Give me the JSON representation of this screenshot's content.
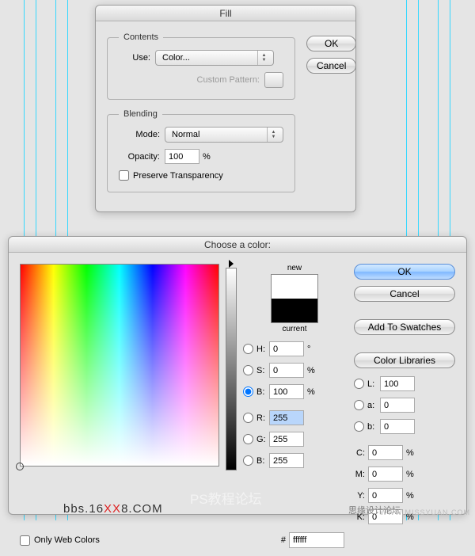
{
  "fill_dialog": {
    "title": "Fill",
    "contents": {
      "legend": "Contents",
      "use_label": "Use:",
      "use_value": "Color...",
      "custom_pattern_label": "Custom Pattern:"
    },
    "blending": {
      "legend": "Blending",
      "mode_label": "Mode:",
      "mode_value": "Normal",
      "opacity_label": "Opacity:",
      "opacity_value": "100",
      "opacity_unit": "%",
      "preserve_label": "Preserve Transparency"
    },
    "buttons": {
      "ok": "OK",
      "cancel": "Cancel"
    }
  },
  "picker_dialog": {
    "title": "Choose a color:",
    "new_label": "new",
    "current_label": "current",
    "only_web_label": "Only Web Colors",
    "hex_prefix": "#",
    "hex_value": "ffffff",
    "buttons": {
      "ok": "OK",
      "cancel": "Cancel",
      "add_swatches": "Add To Swatches",
      "color_libraries": "Color Libraries"
    },
    "hsb": {
      "h_label": "H:",
      "h_value": "0",
      "h_unit": "°",
      "s_label": "S:",
      "s_value": "0",
      "s_unit": "%",
      "b_label": "B:",
      "b_value": "100",
      "b_unit": "%"
    },
    "rgb": {
      "r_label": "R:",
      "r_value": "255",
      "g_label": "G:",
      "g_value": "255",
      "b_label": "B:",
      "b_value": "255"
    },
    "lab": {
      "l_label": "L:",
      "l_value": "100",
      "a_label": "a:",
      "a_value": "0",
      "b_label": "b:",
      "b_value": "0"
    },
    "cmyk": {
      "c_label": "C:",
      "c_value": "0",
      "unit": "%",
      "m_label": "M:",
      "m_value": "0",
      "y_label": "Y:",
      "y_value": "0",
      "k_label": "K:",
      "k_value": "0"
    }
  },
  "watermarks": {
    "bbs_prefix": "bbs.16",
    "bbs_xx": "XX",
    "bbs_suffix": "8.COM",
    "ps_forum": "PS教程论坛",
    "design_forum": "思缘设计论坛",
    "missyuan": "WWW.MISSYUAN.COM"
  }
}
